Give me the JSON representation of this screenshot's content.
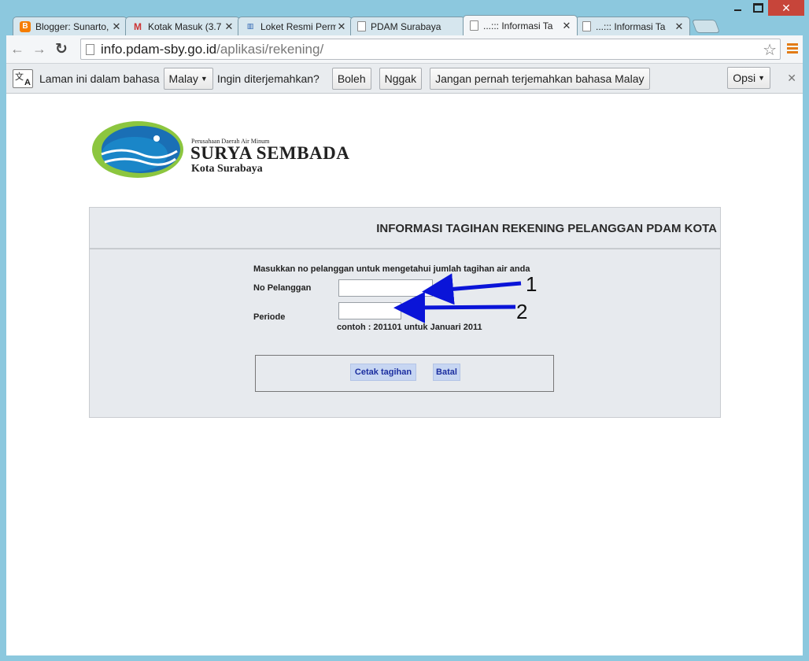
{
  "tabs": [
    {
      "label": "Blogger: Sunarto,",
      "icon": "blogger-icon",
      "active": false
    },
    {
      "label": "Kotak Masuk (3.7",
      "icon": "gmail-icon",
      "active": false
    },
    {
      "label": "Loket Resmi Perm",
      "icon": "loket-icon",
      "active": false
    },
    {
      "label": "PDAM Surabaya",
      "icon": "page-icon",
      "active": false
    },
    {
      "label": "...::: Informasi Ta",
      "icon": "page-icon",
      "active": true
    },
    {
      "label": "...::: Informasi Ta",
      "icon": "page-icon",
      "active": false
    }
  ],
  "omnibox": {
    "host": "info.pdam-sby.go.id",
    "path": "/aplikasi/rekening/"
  },
  "translate": {
    "prompt": "Laman ini dalam bahasa",
    "language": "Malay",
    "question": "Ingin diterjemahkan?",
    "yes_label": "Boleh",
    "no_label": "Nggak",
    "never_label": "Jangan pernah terjemahkan bahasa Malay",
    "options_label": "Opsi"
  },
  "logo": {
    "small": "Perusahaan Daerah Air Minum",
    "name": "SURYA SEMBADA",
    "city": "Kota Surabaya"
  },
  "form": {
    "title": "INFORMASI TAGIHAN REKENING PELANGGAN PDAM KOTA",
    "intro": "Masukkan no pelanggan untuk mengetahui jumlah tagihan air anda",
    "customer_label": "No Pelanggan",
    "customer_value": "",
    "period_label": "Periode",
    "period_value": "",
    "hint": "contoh : 201101 untuk Januari 2011",
    "print_label": "Cetak tagihan",
    "cancel_label": "Batal"
  },
  "annotations": {
    "arrow1_number": "1",
    "arrow2_number": "2",
    "arrow_color": "#0a14d8"
  },
  "colors": {
    "frame": "#8cc8de",
    "panel": "#e7eaee",
    "button": "#c7d6f2",
    "button_text": "#1c2fa0"
  }
}
